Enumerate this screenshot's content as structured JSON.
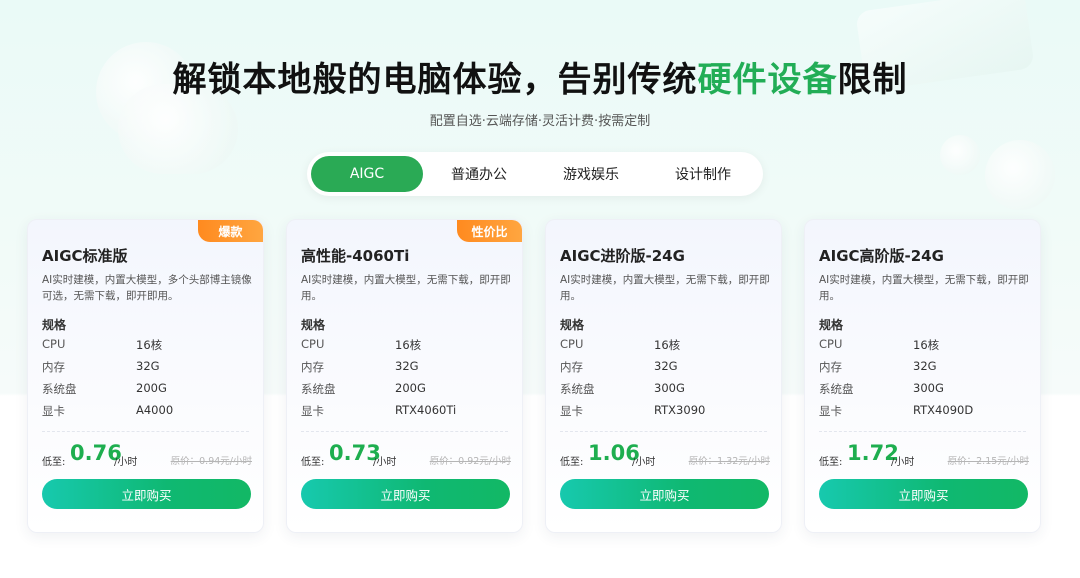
{
  "hero": {
    "title_prefix": "解锁本地般的电脑体验，告别传统",
    "title_highlight": "硬件设备",
    "title_suffix": "限制",
    "subtitle": "配置自选·云端存储·灵活计费·按需定制"
  },
  "tabs": [
    {
      "label": "AIGC",
      "active": true
    },
    {
      "label": "普通办公",
      "active": false
    },
    {
      "label": "游戏娱乐",
      "active": false
    },
    {
      "label": "设计制作",
      "active": false
    }
  ],
  "colors": {
    "accent": "#2aaa55",
    "price": "#1eae4f",
    "badge": "#ff8a1f"
  },
  "labels": {
    "spec_title": "规格",
    "cpu": "CPU",
    "memory": "内存",
    "disk": "系统盘",
    "gpu": "显卡",
    "price_prefix": "低至:",
    "price_unit": "/小时",
    "buy": "立即购买"
  },
  "cards": [
    {
      "badge": "爆款",
      "title": "AIGC标准版",
      "desc": "AI实时建模，内置大模型，多个头部博主镜像可选，无需下载，即开即用。",
      "cpu": "16核",
      "memory": "32G",
      "disk": "200G",
      "gpu": "A4000",
      "price": "0.76",
      "original": "原价：0.94元/小时"
    },
    {
      "badge": "性价比",
      "title": "高性能-4060Ti",
      "desc": "AI实时建模，内置大模型，无需下载，即开即用。",
      "cpu": "16核",
      "memory": "32G",
      "disk": "200G",
      "gpu": "RTX4060Ti",
      "price": "0.73",
      "original": "原价：0.92元/小时"
    },
    {
      "badge": "",
      "title": "AIGC进阶版-24G",
      "desc": "AI实时建模，内置大模型，无需下载，即开即用。",
      "cpu": "16核",
      "memory": "32G",
      "disk": "300G",
      "gpu": "RTX3090",
      "price": "1.06",
      "original": "原价：1.32元/小时"
    },
    {
      "badge": "",
      "title": "AIGC高阶版-24G",
      "desc": "AI实时建模，内置大模型，无需下载，即开即用。",
      "cpu": "16核",
      "memory": "32G",
      "disk": "300G",
      "gpu": "RTX4090D",
      "price": "1.72",
      "original": "原价：2.15元/小时"
    }
  ]
}
